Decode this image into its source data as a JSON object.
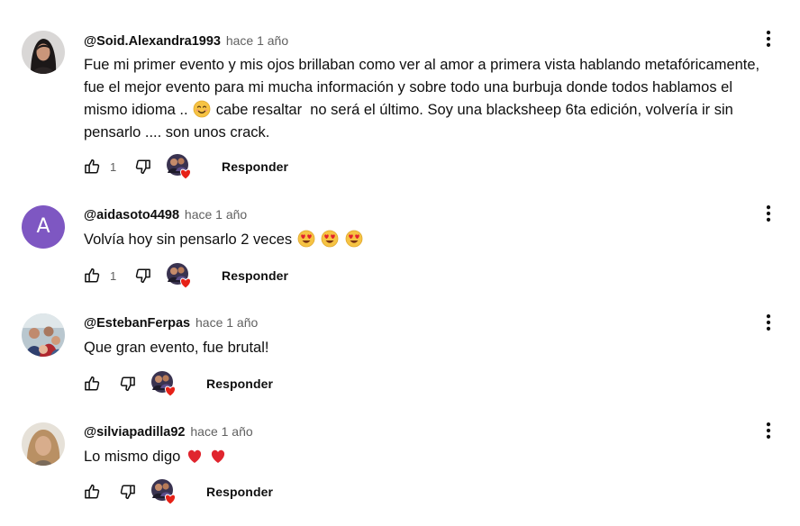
{
  "colors": {
    "text": "#0f0f0f",
    "secondary": "#606060",
    "heart": "#e62117",
    "avatar_letter_bg": "#7e57c2"
  },
  "icons": {
    "like": "thumb-up-icon",
    "dislike": "thumb-down-icon",
    "menu": "more-vert-icon",
    "creator_heart": "creator-heart-icon"
  },
  "comments": [
    {
      "author": "@Soid.Alexandra1993",
      "time": "hace 1 año",
      "text_lines": [
        "Fue mi primer evento y mis ojos brillaban como ver al amor a primera vista hablando metafóricamente,",
        "fue el mejor evento para mi mucha información y sobre todo una burbuja donde todos hablamos el",
        "mismo idioma .. ",
        " cabe resaltar  no será el último. Soy una blacksheep 6ta edición, volvería ir sin",
        "pensarlo .... son unos crack."
      ],
      "likes": "1",
      "reply_label": "Responder"
    },
    {
      "author": "@aidasoto4498",
      "time": "hace 1 año",
      "avatar_letter": "A",
      "text": "Volvía hoy sin pensarlo 2 veces ",
      "likes": "1",
      "reply_label": "Responder"
    },
    {
      "author": "@EstebanFerpas",
      "time": "hace 1 año",
      "text": "Que gran evento, fue brutal!",
      "likes": "",
      "reply_label": "Responder"
    },
    {
      "author": "@silviapadilla92",
      "time": "hace 1 año",
      "text": "Lo mismo digo ",
      "likes": "",
      "reply_label": "Responder"
    }
  ]
}
